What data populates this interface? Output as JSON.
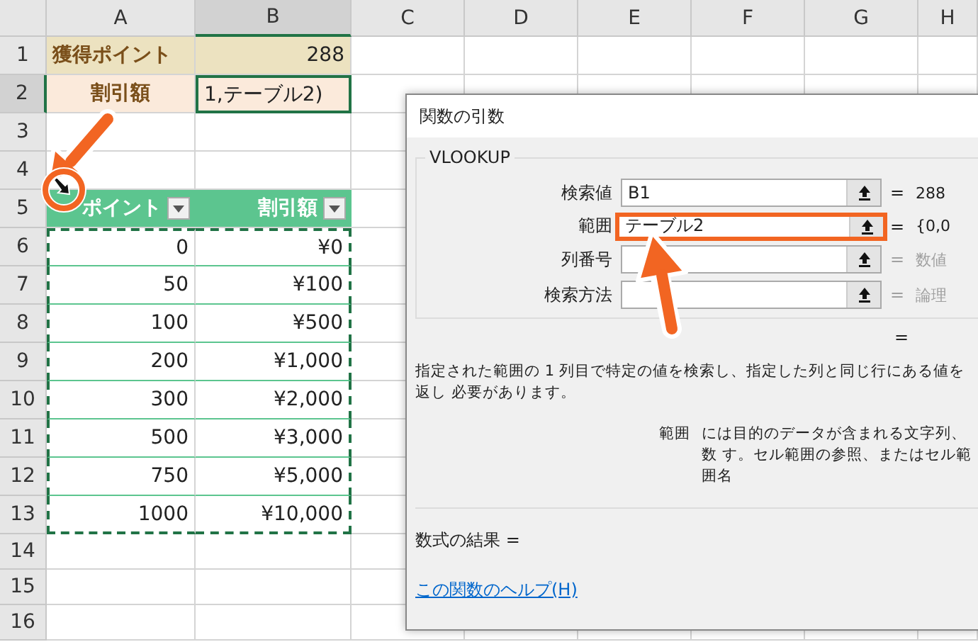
{
  "columns": [
    {
      "label": "A",
      "selected": false
    },
    {
      "label": "B",
      "selected": true
    },
    {
      "label": "C",
      "selected": false
    },
    {
      "label": "D",
      "selected": false
    },
    {
      "label": "E",
      "selected": false
    },
    {
      "label": "F",
      "selected": false
    },
    {
      "label": "G",
      "selected": false
    },
    {
      "label": "H",
      "selected": false
    }
  ],
  "rows": [
    {
      "number": "1",
      "kind": "points",
      "selected": false,
      "cells": [
        "獲得ポイント",
        "288"
      ]
    },
    {
      "number": "2",
      "kind": "discount",
      "selected": true,
      "cells": [
        "割引額",
        "1,テーブル2)"
      ]
    },
    {
      "number": "3",
      "kind": "blank",
      "selected": false,
      "cells": []
    },
    {
      "number": "4",
      "kind": "blank",
      "selected": false,
      "cells": []
    },
    {
      "number": "5",
      "kind": "table_header",
      "selected": false,
      "cells": [
        "ポイント",
        "割引額"
      ]
    },
    {
      "number": "6",
      "kind": "table_body",
      "selected": false,
      "cells": [
        "0",
        "¥0"
      ]
    },
    {
      "number": "7",
      "kind": "table_body",
      "selected": false,
      "cells": [
        "50",
        "¥100"
      ]
    },
    {
      "number": "8",
      "kind": "table_body",
      "selected": false,
      "cells": [
        "100",
        "¥500"
      ]
    },
    {
      "number": "9",
      "kind": "table_body",
      "selected": false,
      "cells": [
        "200",
        "¥1,000"
      ]
    },
    {
      "number": "10",
      "kind": "table_body",
      "selected": false,
      "cells": [
        "300",
        "¥2,000"
      ]
    },
    {
      "number": "11",
      "kind": "table_body",
      "selected": false,
      "cells": [
        "500",
        "¥3,000"
      ]
    },
    {
      "number": "12",
      "kind": "table_body",
      "selected": false,
      "cells": [
        "750",
        "¥5,000"
      ]
    },
    {
      "number": "13",
      "kind": "table_body",
      "selected": false,
      "cells": [
        "1000",
        "¥10,000"
      ]
    },
    {
      "number": "14",
      "kind": "blank",
      "selected": false,
      "cells": []
    },
    {
      "number": "15",
      "kind": "blank",
      "selected": false,
      "cells": []
    },
    {
      "number": "16",
      "kind": "blank",
      "selected": false,
      "cells": []
    }
  ],
  "dialog": {
    "title": "関数の引数",
    "function_name": "VLOOKUP",
    "arguments": [
      {
        "label": "検索値",
        "value": "B1",
        "result": "288",
        "highlighted": false,
        "disabled": false
      },
      {
        "label": "範囲",
        "value": "テーブル2",
        "result": "{0,0",
        "highlighted": true,
        "disabled": false
      },
      {
        "label": "列番号",
        "result": "数値",
        "highlighted": false,
        "disabled": true
      },
      {
        "label": "検索方法",
        "result": "論理",
        "highlighted": false,
        "disabled": true
      }
    ],
    "equals": "=",
    "description": "指定された範囲の 1 列目で特定の値を検索し、指定した列と同じ行にある値を返し 必要があります。",
    "argument_name": "範囲",
    "argument_help": "には目的のデータが含まれる文字列、数 す。セル範囲の参照、またはセル範囲名",
    "formula_result": "数式の結果 =",
    "help_link": "この関数のヘルプ(H)"
  }
}
